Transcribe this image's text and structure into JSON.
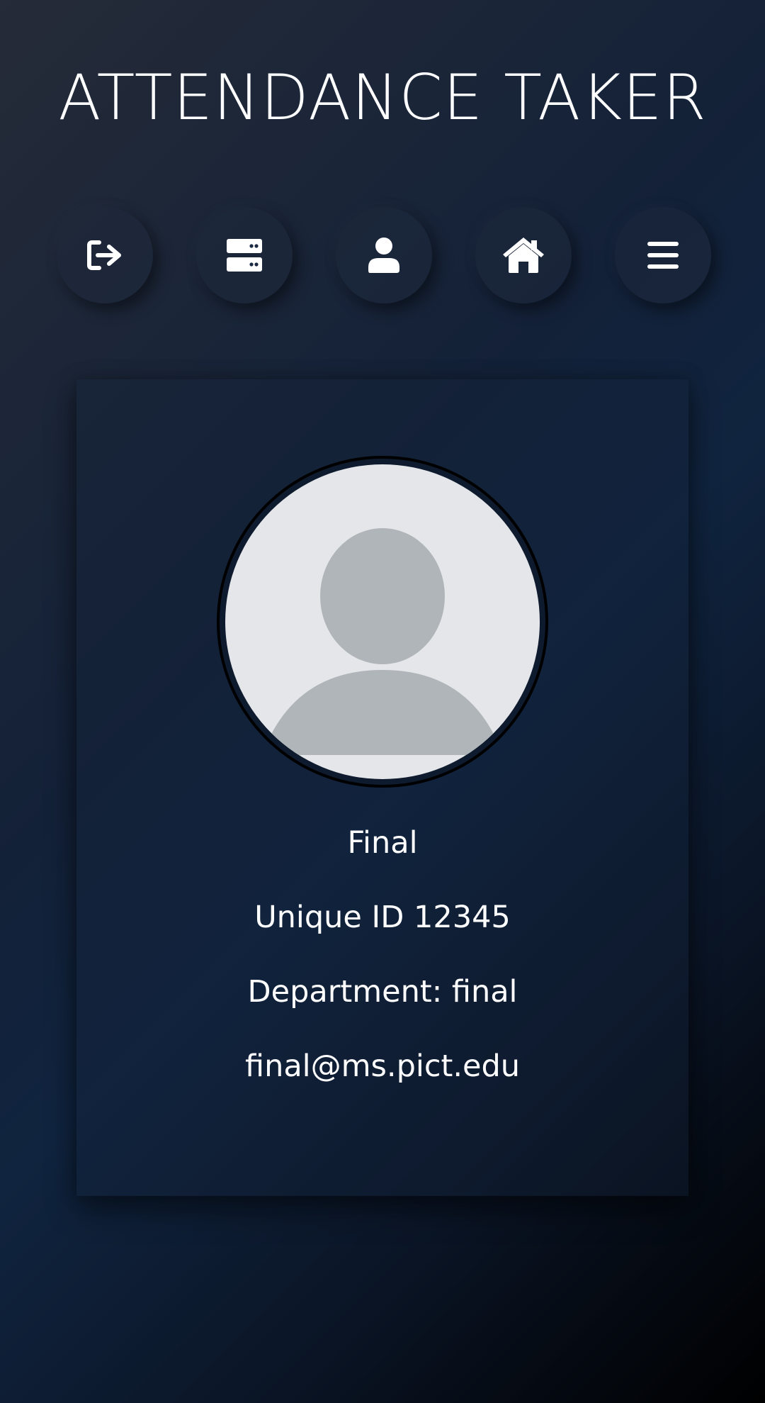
{
  "app": {
    "title": "ATTENDANCE TAKER"
  },
  "nav": {
    "buttons": [
      {
        "icon": "sign-out-icon",
        "label": ""
      },
      {
        "icon": "server-icon",
        "label": ""
      },
      {
        "icon": "user-icon",
        "label": ""
      },
      {
        "icon": "home-icon",
        "label": ""
      },
      {
        "icon": "menu-icon",
        "label": ""
      }
    ]
  },
  "profile": {
    "name": "Final",
    "unique_id": "Unique ID 12345",
    "department": "Department: final",
    "email": "final@ms.pict.edu"
  },
  "colors": {
    "background_start": "#252b38",
    "background_mid": "#10243f",
    "background_end": "#000000",
    "avatar_bg": "#e4e6e9",
    "avatar_silhouette": "#b0b5ba",
    "text": "#ffffff"
  }
}
